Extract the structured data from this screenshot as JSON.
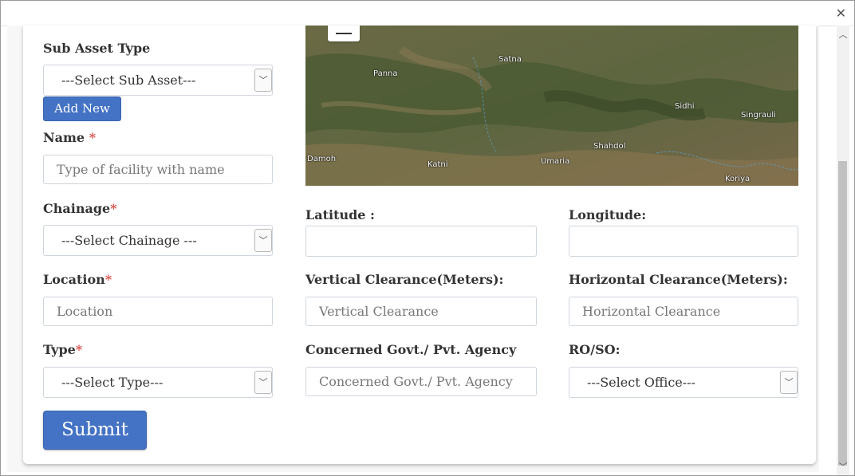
{
  "window": {
    "close_glyph": "✕"
  },
  "form": {
    "sub_asset_type": {
      "label": "Sub Asset Type",
      "selected": "---Select Sub Asset---"
    },
    "add_new_button": "Add New",
    "name": {
      "label": "Name",
      "required_mark": "*",
      "placeholder": "Type of facility with name"
    },
    "chainage": {
      "label": "Chainage",
      "required_mark": "*",
      "selected": "---Select Chainage ---"
    },
    "latitude": {
      "label": "Latitude :",
      "value": ""
    },
    "longitude": {
      "label": "Longitude:",
      "value": ""
    },
    "location": {
      "label": "Location",
      "required_mark": "*",
      "placeholder": "Location"
    },
    "vertical_clearance": {
      "label": "Vertical Clearance(Meters):",
      "placeholder": "Vertical Clearance"
    },
    "horizontal_clearance": {
      "label": "Horizontal Clearance(Meters):",
      "placeholder": "Horizontal Clearance"
    },
    "type": {
      "label": "Type",
      "required_mark": "*",
      "selected": "---Select Type---"
    },
    "concerned_agency": {
      "label": "Concerned Govt./ Pvt. Agency",
      "placeholder": "Concerned Govt./ Pvt. Agency"
    },
    "ro_so": {
      "label": "RO/SO:",
      "selected": "---Select Office---"
    },
    "submit_button": "Submit"
  },
  "map": {
    "zoom_out_icon": "minus-icon",
    "places": [
      "Satna",
      "Panna",
      "Sidhi",
      "Singrauli",
      "Shahdol",
      "Damoh",
      "Katni",
      "Umaria",
      "Koriya"
    ]
  },
  "colors": {
    "primary_button": "#4472c4",
    "required": "#d9534f"
  }
}
